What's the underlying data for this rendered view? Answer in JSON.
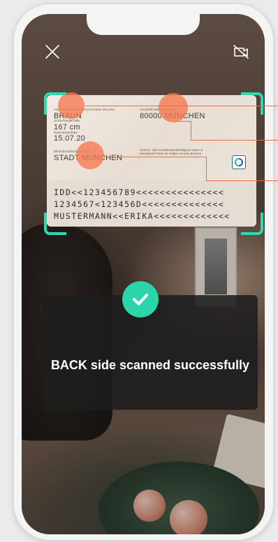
{
  "header": {
    "close_icon": "close-icon",
    "flash_icon": "flash-off-icon"
  },
  "id_card": {
    "eye_color_label": "Augenfarbe/Colour of eyes/Couleur des yeux",
    "eye_color_value": "BRAUN",
    "height_label": "Größe/Height/Taille",
    "height_value": "167 cm",
    "date_label": "Datum/Date/Date",
    "date_value": "15.07.20",
    "authority_label": "Behörde/Authority/Autorité",
    "authority_value": "STADT MÜNCHEN",
    "address_label": "Anschrift/Address/Adresse",
    "address_value": "80000 MÜNCHEN",
    "religious_label": "Ordens- oder Künstlername/Religious name or pseudonym/ Nom de religion ou pseudonyme",
    "mrz_line_1": "IDD<<123456789<<<<<<<<<<<<<<<",
    "mrz_line_2": "1234567<123456D<<<<<<<<<<<<<<",
    "mrz_line_3": "MUSTERMANN<<ERIKA<<<<<<<<<<<<<"
  },
  "status": {
    "message": "BACK side scanned successfully",
    "icon": "checkmark-icon"
  },
  "colors": {
    "accent": "#2ed8b0",
    "hotspot": "#f26b47",
    "success": "#2bd5aa"
  }
}
